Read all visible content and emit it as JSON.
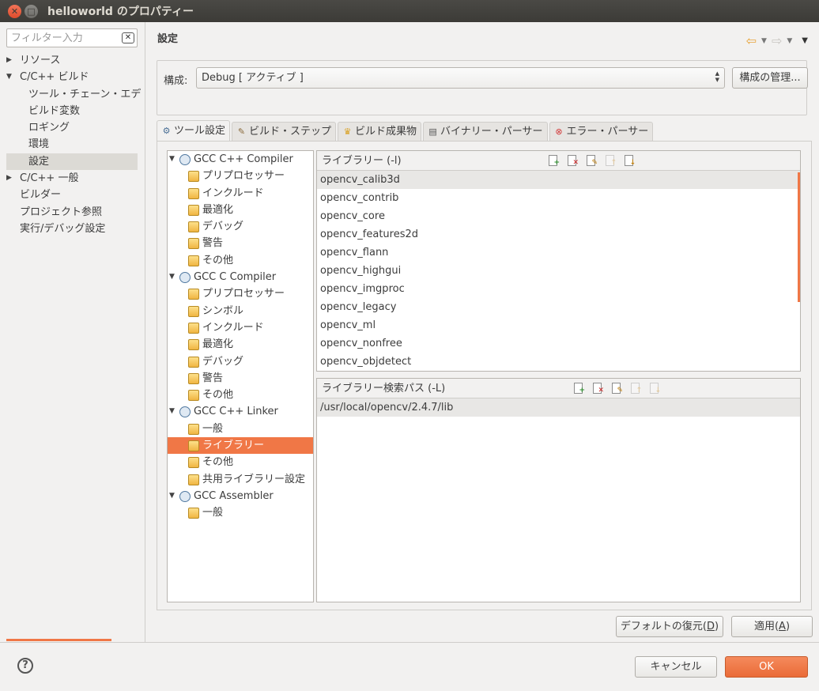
{
  "window": {
    "title": "helloworld のプロパティー"
  },
  "left": {
    "filter_placeholder": "フィルター入力",
    "nav": [
      {
        "label": "リソース",
        "level": 0,
        "expander": "▶"
      },
      {
        "label": "C/C++ ビルド",
        "level": 0,
        "expander": "▼"
      },
      {
        "label": "ツール・チェーン・エデ",
        "level": 1,
        "expander": ""
      },
      {
        "label": "ビルド変数",
        "level": 1,
        "expander": ""
      },
      {
        "label": "ロギング",
        "level": 1,
        "expander": ""
      },
      {
        "label": "環境",
        "level": 1,
        "expander": ""
      },
      {
        "label": "設定",
        "level": 1,
        "expander": "",
        "selected": true
      },
      {
        "label": "C/C++ 一般",
        "level": 0,
        "expander": "▶"
      },
      {
        "label": "ビルダー",
        "level": 0,
        "expander": ""
      },
      {
        "label": "プロジェクト参照",
        "level": 0,
        "expander": ""
      },
      {
        "label": "実行/デバッグ設定",
        "level": 0,
        "expander": ""
      }
    ]
  },
  "main": {
    "page_title": "設定",
    "config": {
      "label": "構成:",
      "value": "Debug [ アクティブ ]",
      "manage_button": "構成の管理..."
    },
    "tabs": [
      {
        "label": "ツール設定",
        "icon": "gear-icon",
        "active": true
      },
      {
        "label": "ビルド・ステップ",
        "icon": "hammer-icon",
        "active": false
      },
      {
        "label": "ビルド成果物",
        "icon": "trophy-icon",
        "active": false
      },
      {
        "label": "バイナリー・パーサー",
        "icon": "binary-icon",
        "active": false
      },
      {
        "label": "エラー・パーサー",
        "icon": "error-icon",
        "active": false
      }
    ],
    "tool_tree": [
      {
        "label": "GCC C++ Compiler",
        "type": "tool",
        "expander": "▼"
      },
      {
        "label": "プリプロセッサー",
        "type": "option"
      },
      {
        "label": "インクルード",
        "type": "option"
      },
      {
        "label": "最適化",
        "type": "option"
      },
      {
        "label": "デバッグ",
        "type": "option"
      },
      {
        "label": "警告",
        "type": "option"
      },
      {
        "label": "その他",
        "type": "option"
      },
      {
        "label": "GCC C Compiler",
        "type": "tool",
        "expander": "▼"
      },
      {
        "label": "プリプロセッサー",
        "type": "option"
      },
      {
        "label": "シンボル",
        "type": "option"
      },
      {
        "label": "インクルード",
        "type": "option"
      },
      {
        "label": "最適化",
        "type": "option"
      },
      {
        "label": "デバッグ",
        "type": "option"
      },
      {
        "label": "警告",
        "type": "option"
      },
      {
        "label": "その他",
        "type": "option"
      },
      {
        "label": "GCC C++ Linker",
        "type": "tool",
        "expander": "▼"
      },
      {
        "label": "一般",
        "type": "option"
      },
      {
        "label": "ライブラリー",
        "type": "option",
        "selected": true
      },
      {
        "label": "その他",
        "type": "option"
      },
      {
        "label": "共用ライブラリー設定",
        "type": "option"
      },
      {
        "label": "GCC Assembler",
        "type": "tool",
        "expander": "▼"
      },
      {
        "label": "一般",
        "type": "option"
      }
    ],
    "libraries": {
      "header": "ライブラリー (-l)",
      "items": [
        "opencv_calib3d",
        "opencv_contrib",
        "opencv_core",
        "opencv_features2d",
        "opencv_flann",
        "opencv_highgui",
        "opencv_imgproc",
        "opencv_legacy",
        "opencv_ml",
        "opencv_nonfree",
        "opencv_objdetect"
      ]
    },
    "lib_paths": {
      "header": "ライブラリー検索パス (-L)",
      "items": [
        "/usr/local/opencv/2.4.7/lib"
      ]
    },
    "restore_defaults_label": "デフォルトの復元(",
    "restore_defaults_key": "D",
    "apply_label": "適用(",
    "apply_key": "A"
  },
  "footer": {
    "cancel": "キャンセル",
    "ok": "OK"
  },
  "colors": {
    "accent": "#f07746",
    "titlebar": "#3c3b37",
    "background": "#f2f1f0"
  }
}
